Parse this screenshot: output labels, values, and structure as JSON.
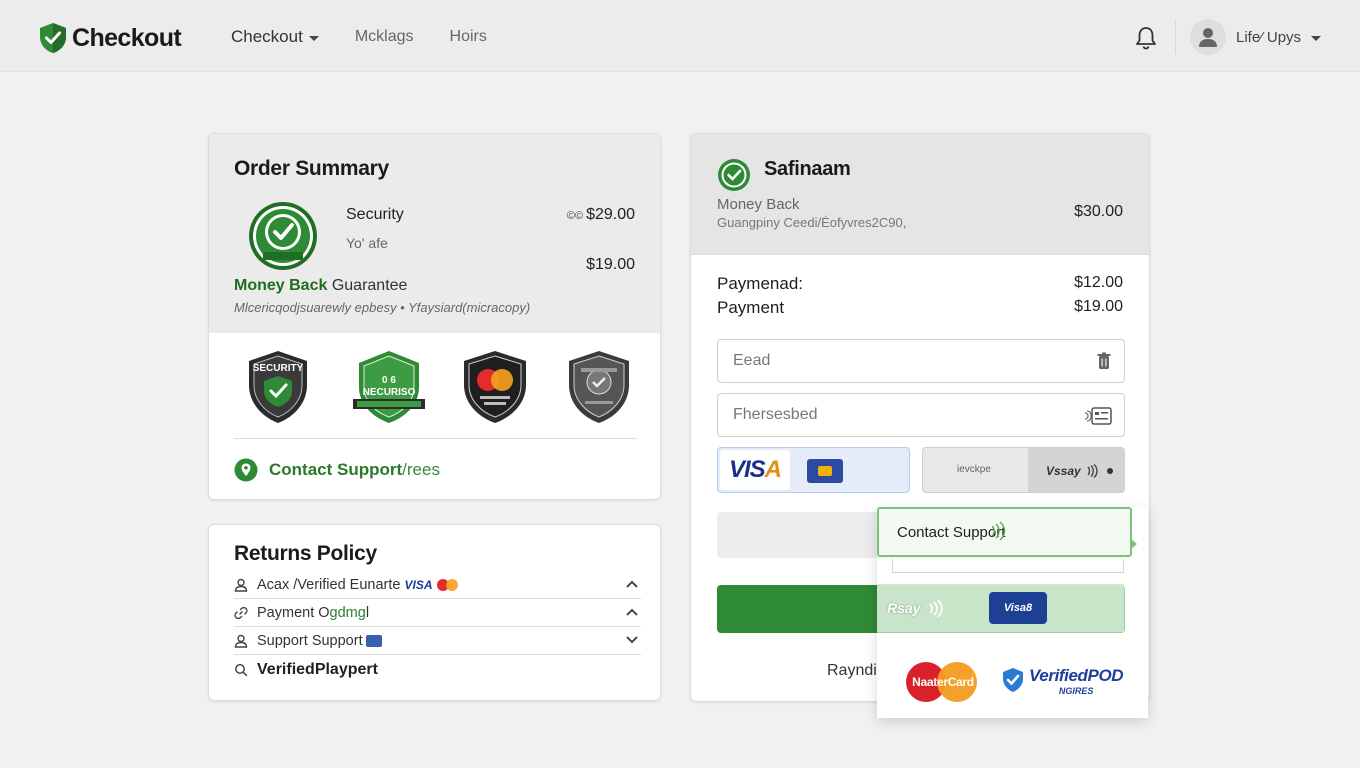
{
  "header": {
    "brand": "Checkout",
    "nav": [
      {
        "label": "Checkout",
        "has_caret": true
      },
      {
        "label": "Mcklags"
      },
      {
        "label": "Hoirs"
      }
    ],
    "user_label": "Life⁄ Upys"
  },
  "order_summary": {
    "title": "Order Summary",
    "item_name": "Security",
    "item_sub": "Yo' afe",
    "price_prefix": "©©",
    "price_1": "$29.00",
    "price_2": "$19.00",
    "guarantee_green": "Money Back",
    "guarantee_rest": " Guarantee",
    "guarantee_sub": "Mlcericqodjsuarewly epbesy • Yfaysiard(micracopy)",
    "badges": [
      {
        "icon": "security-shield-badge",
        "text": "SECURITY"
      },
      {
        "icon": "secured-shield-badge",
        "text": "NECURISO"
      },
      {
        "icon": "mastercard-shield-badge",
        "text": ""
      },
      {
        "icon": "verified-shield-badge",
        "text": ""
      }
    ],
    "contact_label": "Contact Support",
    "contact_tail": "/rees"
  },
  "returns_policy": {
    "title": "Returns Policy",
    "rows": [
      {
        "icon": "user-icon",
        "label": "Acax /Verified Eunarte",
        "extra": "VISA",
        "chevron": "up"
      },
      {
        "icon": "link-icon",
        "label": "Payment O",
        "label_green": "gdmg",
        "label_end": "l",
        "chevron": "up"
      },
      {
        "icon": "user-icon",
        "label": "Support Support",
        "chevron": "down"
      },
      {
        "icon": "search-icon",
        "label": "Verified ",
        "label_green": "Playpert"
      }
    ]
  },
  "payment_card": {
    "title": "Safinaam",
    "sub_1": "Money Back",
    "sub_2": "Guangpiny Ceedi/Éofyvres2C90,",
    "head_price": "$30.00",
    "lines": [
      {
        "label": "Paymenad:",
        "price": "$12.00"
      },
      {
        "label": "Payment",
        "price": "$19.00"
      }
    ],
    "field_1_placeholder": "Eead",
    "field_2_placeholder": "Fhersesbed",
    "visa_label_a": "VIS",
    "visa_label_b": "A",
    "other_method_label": "ievckpe",
    "other_method_brand": "Vssay",
    "bottom_text": "Rayndi"
  },
  "popover": {
    "support_label": "Contact Support",
    "pay_text": "Rsay",
    "visa_chip": "Visa8",
    "mastercard_label": "NaaterCard",
    "verified_main": "VerifiedPOD",
    "verified_sub": "NGIRES"
  },
  "colors": {
    "brand_green": "#2f8a35",
    "accent_green_text": "#1d6e1d",
    "visa_blue": "#1a2f8f",
    "mastercard_red": "#d9202b",
    "mastercard_orange": "#f49b1f"
  }
}
